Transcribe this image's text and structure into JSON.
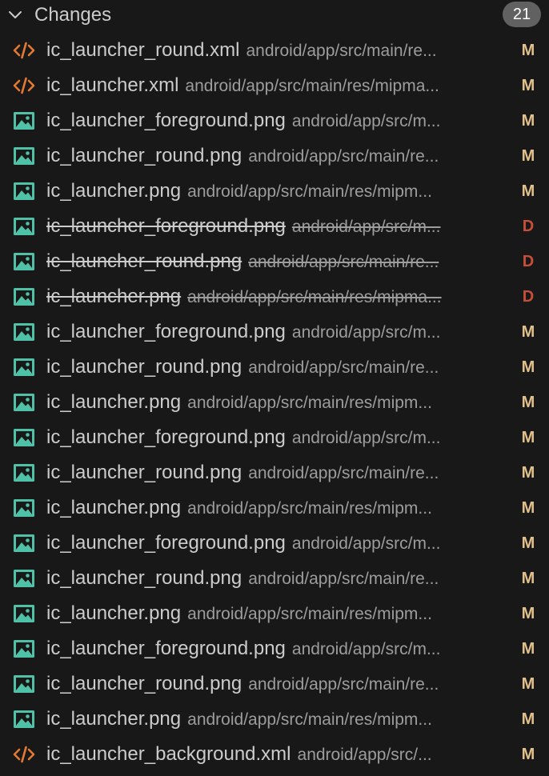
{
  "header": {
    "title": "Changes",
    "count": "21"
  },
  "colors": {
    "xml_icon": "#e37933",
    "image_icon": "#4fc1a6",
    "modified": "#e2c08d",
    "deleted": "#c74e39",
    "badge_bg": "#616161"
  },
  "files": [
    {
      "name": "ic_launcher_round.xml",
      "path": "android/app/src/main/re...",
      "status": "M",
      "icon": "xml-code-icon"
    },
    {
      "name": "ic_launcher.xml",
      "path": "android/app/src/main/res/mipma...",
      "status": "M",
      "icon": "xml-code-icon"
    },
    {
      "name": "ic_launcher_foreground.png",
      "path": "android/app/src/m...",
      "status": "M",
      "icon": "image-file-icon"
    },
    {
      "name": "ic_launcher_round.png",
      "path": "android/app/src/main/re...",
      "status": "M",
      "icon": "image-file-icon"
    },
    {
      "name": "ic_launcher.png",
      "path": "android/app/src/main/res/mipm...",
      "status": "M",
      "icon": "image-file-icon"
    },
    {
      "name": "ic_launcher_foreground.png",
      "path": "android/app/src/m...",
      "status": "D",
      "icon": "image-file-icon"
    },
    {
      "name": "ic_launcher_round.png",
      "path": "android/app/src/main/re...",
      "status": "D",
      "icon": "image-file-icon"
    },
    {
      "name": "ic_launcher.png",
      "path": "android/app/src/main/res/mipma...",
      "status": "D",
      "icon": "image-file-icon"
    },
    {
      "name": "ic_launcher_foreground.png",
      "path": "android/app/src/m...",
      "status": "M",
      "icon": "image-file-icon"
    },
    {
      "name": "ic_launcher_round.png",
      "path": "android/app/src/main/re...",
      "status": "M",
      "icon": "image-file-icon"
    },
    {
      "name": "ic_launcher.png",
      "path": "android/app/src/main/res/mipm...",
      "status": "M",
      "icon": "image-file-icon"
    },
    {
      "name": "ic_launcher_foreground.png",
      "path": "android/app/src/m...",
      "status": "M",
      "icon": "image-file-icon"
    },
    {
      "name": "ic_launcher_round.png",
      "path": "android/app/src/main/re...",
      "status": "M",
      "icon": "image-file-icon"
    },
    {
      "name": "ic_launcher.png",
      "path": "android/app/src/main/res/mipm...",
      "status": "M",
      "icon": "image-file-icon"
    },
    {
      "name": "ic_launcher_foreground.png",
      "path": "android/app/src/m...",
      "status": "M",
      "icon": "image-file-icon"
    },
    {
      "name": "ic_launcher_round.png",
      "path": "android/app/src/main/re...",
      "status": "M",
      "icon": "image-file-icon"
    },
    {
      "name": "ic_launcher.png",
      "path": "android/app/src/main/res/mipm...",
      "status": "M",
      "icon": "image-file-icon"
    },
    {
      "name": "ic_launcher_foreground.png",
      "path": "android/app/src/m...",
      "status": "M",
      "icon": "image-file-icon"
    },
    {
      "name": "ic_launcher_round.png",
      "path": "android/app/src/main/re...",
      "status": "M",
      "icon": "image-file-icon"
    },
    {
      "name": "ic_launcher.png",
      "path": "android/app/src/main/res/mipm...",
      "status": "M",
      "icon": "image-file-icon"
    },
    {
      "name": "ic_launcher_background.xml",
      "path": "android/app/src/...",
      "status": "M",
      "icon": "xml-code-icon"
    }
  ]
}
